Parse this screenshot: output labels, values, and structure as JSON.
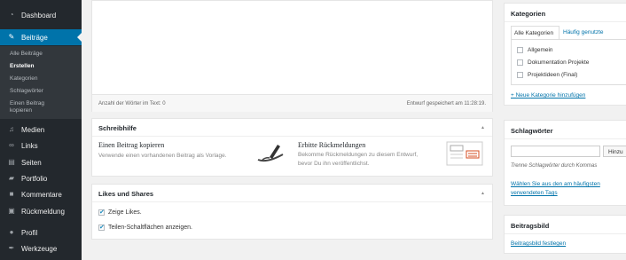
{
  "sidebar": {
    "items": [
      {
        "label": "Dashboard",
        "icon": "dashboard-icon"
      },
      {
        "label": "Beiträge",
        "icon": "pin-icon"
      },
      {
        "label": "Medien",
        "icon": "media-icon"
      },
      {
        "label": "Links",
        "icon": "link-icon"
      },
      {
        "label": "Seiten",
        "icon": "pages-icon"
      },
      {
        "label": "Portfolio",
        "icon": "portfolio-icon"
      },
      {
        "label": "Kommentare",
        "icon": "comments-icon"
      },
      {
        "label": "Rückmeldung",
        "icon": "feedback-icon"
      },
      {
        "label": "Profil",
        "icon": "profile-icon"
      },
      {
        "label": "Werkzeuge",
        "icon": "tools-icon"
      }
    ],
    "submenu": [
      "Alle Beiträge",
      "Erstellen",
      "Kategorien",
      "Schlagwörter",
      "Einen Beitrag kopieren"
    ]
  },
  "editor": {
    "word_count": "Anzahl der Wörter im Text: 0",
    "draft_saved": "Entwurf gespeichert am 11:28:19."
  },
  "schreibhilfe": {
    "title": "Schreibhilfe",
    "copy_title": "Einen Beitrag kopieren",
    "copy_desc": "Verwende einen vorhandenen Beitrag als Vorlage.",
    "feedback_title": "Erbitte Rückmeldungen",
    "feedback_desc_1": "Bekomme Rückmeldungen zu diesem Entwurf,",
    "feedback_desc_2": "bevor Du ihn veröffentlichst."
  },
  "likes": {
    "title": "Likes und Shares",
    "option1": "Zeige Likes.",
    "option2": "Teilen-Schaltflächen anzeigen."
  },
  "kategorien": {
    "title": "Kategorien",
    "tab_all": "Alle Kategorien",
    "tab_used": "Häufig genutzte",
    "items": [
      "Allgemein",
      "Dokumentation Projekte",
      "Projektideen (Final)"
    ],
    "add_link": "+ Neue Kategorie hinzufügen"
  },
  "schlagwoerter": {
    "title": "Schlagwörter",
    "add_button": "Hinzu",
    "hint": "Trenne Schlagwörter durch Kommas",
    "choose_line1": "Wählen Sie aus den am häufigsten",
    "choose_line2": "verwendeten Tags"
  },
  "beitragsbild": {
    "title": "Beitragsbild",
    "set_link": "Beitragsbild festlegen"
  },
  "colors": {
    "sidebar": "#23282d",
    "active": "#0073aa",
    "link": "#0073aa"
  }
}
